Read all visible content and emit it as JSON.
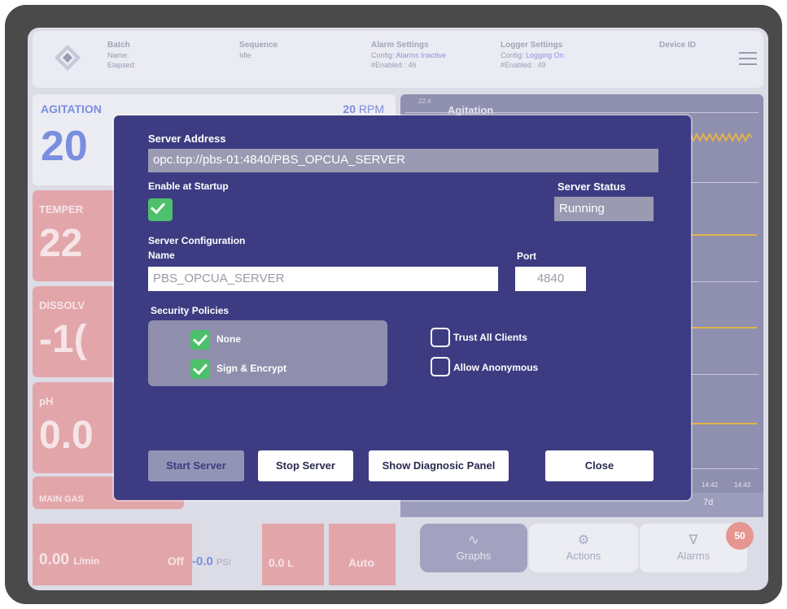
{
  "header": {
    "batch": {
      "title": "Batch",
      "name_label": "Name:",
      "elapsed_label": "Elapsed:"
    },
    "sequence": {
      "title": "Sequence",
      "value": "Idle"
    },
    "alarm_settings": {
      "title": "Alarm Settings",
      "config_label": "Config:",
      "config_value": "Alarms Inactive",
      "enabled": "#Enabled : 46"
    },
    "logger_settings": {
      "title": "Logger Settings",
      "config_label": "Config:",
      "config_value": "Logging On",
      "enabled": "#Enabled : 49"
    },
    "device_id": {
      "title": "Device ID"
    }
  },
  "tiles": {
    "agitation": {
      "label": "AGITATION",
      "value": "20",
      "setpoint": "20",
      "unit": "RPM"
    },
    "temperature": {
      "label": "TEMPER",
      "value": "22"
    },
    "dissolved": {
      "label": "DISSOLV",
      "value": "-1("
    },
    "ph": {
      "label": "pH",
      "value": "0.0"
    },
    "main_gas": {
      "label": "MAIN GAS"
    }
  },
  "graph": {
    "title": "Agitation",
    "y_top": "22.4",
    "time_labels": [
      "14:42",
      "14:43"
    ],
    "range_label": "7d"
  },
  "bottom": {
    "flow": {
      "value": "0.00",
      "unit": "L/min",
      "state": "Off"
    },
    "pressure": {
      "value": "-0.0",
      "unit": "PSI"
    },
    "volume": {
      "value": "0.0",
      "unit": "L"
    },
    "mode": "Auto"
  },
  "nav": {
    "graphs": "Graphs",
    "actions": "Actions",
    "alarms": "Alarms",
    "alarm_count": "50"
  },
  "modal": {
    "server_address_label": "Server Address",
    "server_address": "opc.tcp://pbs-01:4840/PBS_OPCUA_SERVER",
    "enable_startup_label": "Enable at Startup",
    "enable_startup_checked": true,
    "server_status_label": "Server Status",
    "server_status": "Running",
    "server_config_label": "Server Configuration",
    "name_label": "Name",
    "name_value": "PBS_OPCUA_SERVER",
    "port_label": "Port",
    "port_value": "4840",
    "security_label": "Security Policies",
    "policies": [
      {
        "label": "None",
        "checked": true
      },
      {
        "label": "Sign & Encrypt",
        "checked": true
      }
    ],
    "options": [
      {
        "label": "Trust All Clients",
        "checked": false
      },
      {
        "label": "Allow Anonymous",
        "checked": false
      }
    ],
    "buttons": {
      "start": "Start Server",
      "stop": "Stop Server",
      "diagnostic": "Show Diagnosic Panel",
      "close": "Close"
    }
  },
  "colors": {
    "modal_bg": "#3d3c82",
    "check_green": "#4cc06a",
    "alarm_red": "#e2a6aa",
    "accent_blue": "#7a8ee0"
  }
}
